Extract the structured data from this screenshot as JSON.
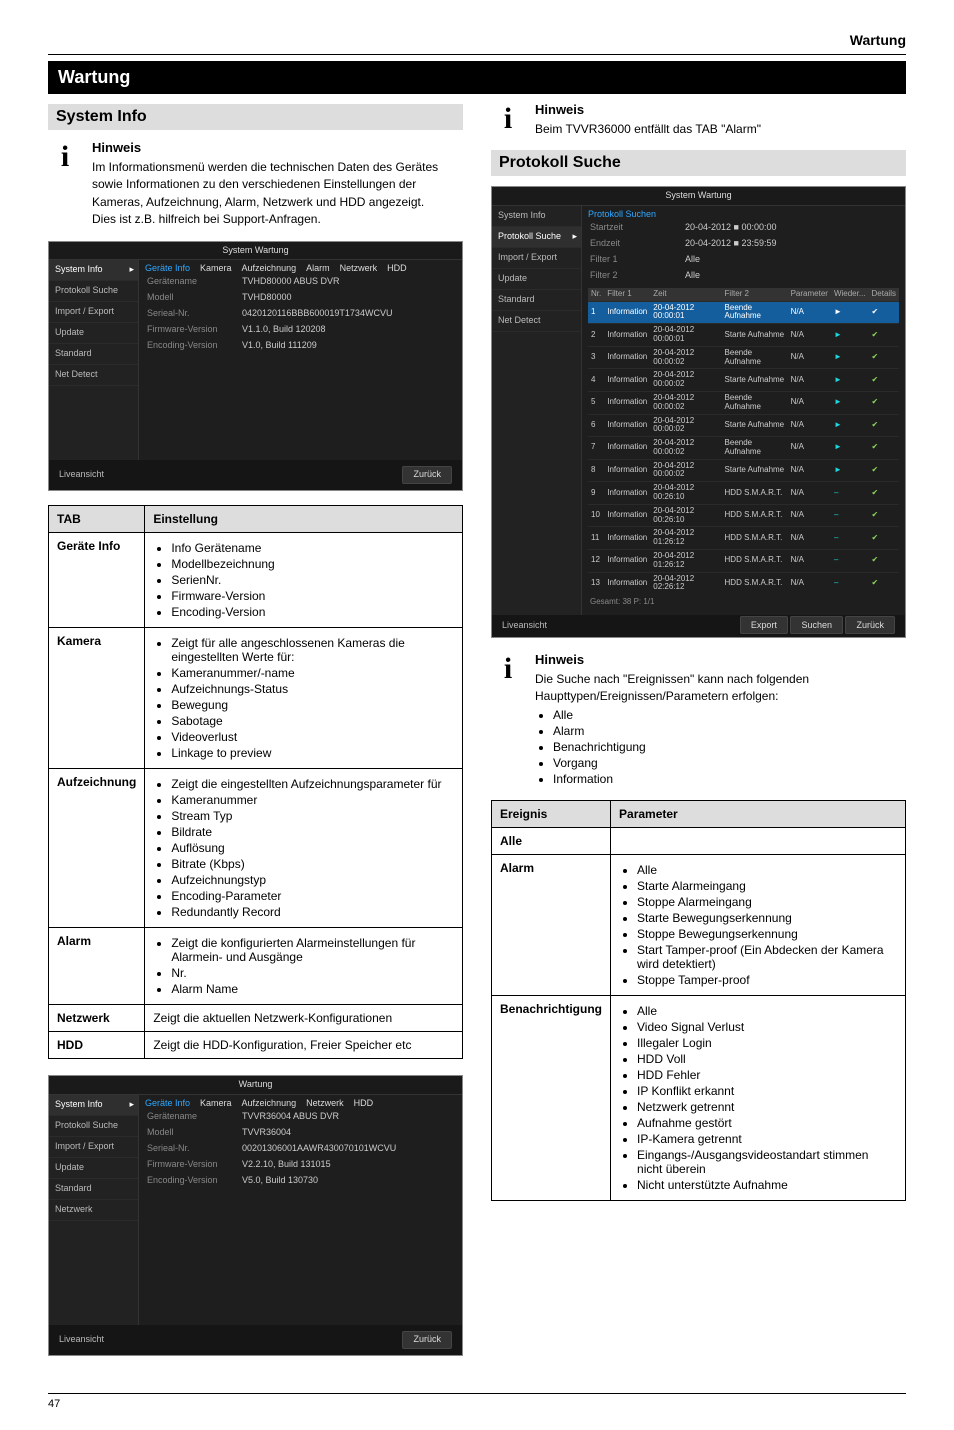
{
  "top_heading": "Wartung",
  "band_title": "Wartung",
  "hint_label": "Hinweis",
  "sysinfo": {
    "heading": "System Info",
    "note1": "Im Informationsmenü werden die technischen Daten des Gerätes sowie Informationen zu den verschiedenen Einstellungen der Kameras, Aufzeichnung, Alarm, Netzwerk und HDD angezeigt.",
    "note2": "Dies ist z.B. hilfreich bei Support-Anfragen.",
    "shot": {
      "title": "System Wartung",
      "side": [
        "System Info",
        "Protokoll Suche",
        "Import / Export",
        "Update",
        "Standard",
        "Net Detect"
      ],
      "side_sel": 0,
      "tabs": [
        "Geräte Info",
        "Kamera",
        "Aufzeichnung",
        "Alarm",
        "Netzwerk",
        "HDD"
      ],
      "kv": [
        {
          "k": "Gerätename",
          "v": "TVHD80000 ABUS DVR"
        },
        {
          "k": "Modell",
          "v": "TVHD80000"
        },
        {
          "k": "Serieal-Nr.",
          "v": "0420120116BBB600019T1734WCVU"
        },
        {
          "k": "Firmware-Version",
          "v": "V1.1.0, Build 120208"
        },
        {
          "k": "Encoding-Version",
          "v": "V1.0, Build 111209"
        }
      ],
      "live": "Liveansicht",
      "back": "Zurück"
    },
    "table": {
      "headers": [
        "TAB",
        "Einstellung"
      ],
      "rows": [
        {
          "tab": "Geräte Info",
          "text": "Info Gerätename\nModellbezeichnung\nSerienNr.\nFirmware-Version\nEncoding-Version",
          "rowspan": 0
        },
        {
          "tab": "Kamera",
          "text": "Zeigt für alle angeschlossenen Kameras die eingestellten Werte für:\nKameranummer/-name\nAufzeichnungs-Status\nBewegung\nSabotage\nVideoverlust\nLinkage to preview"
        },
        {
          "tab": "Aufzeichnung",
          "text": "Zeigt die eingestellten Aufzeichnungsparameter für\nKameranummer\nStream Typ\nBildrate\nAuflösung\nBitrate (Kbps)\nAufzeichnungstyp\nEncoding-Parameter\nRedundantly Record"
        },
        {
          "tab": "Alarm",
          "text": "Zeigt die konfigurierten Alarmeinstellungen für Alarmein- und Ausgänge\nNr.\nAlarm Name"
        },
        {
          "tab": "Netzwerk",
          "text": "Zeigt die aktuellen Netzwerk-Konfigurationen"
        },
        {
          "tab": "HDD",
          "text": "Zeigt die HDD-Konfiguration, Freier Speicher etc"
        }
      ]
    },
    "shot2": {
      "title": "Wartung",
      "side": [
        "System Info",
        "Protokoll Suche",
        "Import / Export",
        "Update",
        "Standard",
        "Netzwerk"
      ],
      "side_sel": 0,
      "tabs": [
        "Geräte Info",
        "Kamera",
        "Aufzeichnung",
        "Netzwerk",
        "HDD"
      ],
      "kv": [
        {
          "k": "Gerätename",
          "v": "TVVR36004 ABUS DVR"
        },
        {
          "k": "Modell",
          "v": "TVVR36004"
        },
        {
          "k": "Serieal-Nr.",
          "v": "00201306001AAWR430070101WCVU"
        },
        {
          "k": "Firmware-Version",
          "v": "V2.2.10, Build 131015"
        },
        {
          "k": "Encoding-Version",
          "v": "V5.0, Build 130730"
        }
      ],
      "live": "Liveansicht",
      "back": "Zurück"
    },
    "note3": "Beim TVVR36000 entfällt das TAB \"Alarm\""
  },
  "protokoll": {
    "heading": "Protokoll Suche",
    "note": "Die Suche nach \"Ereignissen\" kann nach folgenden Haupttypen/Ereignissen/Parametern erfolgen:",
    "types": [
      "Alle",
      "Alarm",
      "Benachrichtigung",
      "Vorgang",
      "Information"
    ],
    "shot": {
      "title": "System Wartung",
      "side": [
        "System Info",
        "Protokoll Suche",
        "Import / Export",
        "Update",
        "Standard",
        "Net Detect"
      ],
      "side_sel": 1,
      "tabs": [
        "Protokoll Suchen"
      ],
      "fields": [
        {
          "label": "Startzeit",
          "date": "20-04-2012",
          "time": "00:00:00"
        },
        {
          "label": "Endzeit",
          "date": "20-04-2012",
          "time": "23:59:59"
        },
        {
          "label": "Filter 1",
          "val": "Alle"
        },
        {
          "label": "Filter 2",
          "val": "Alle"
        }
      ],
      "cols": [
        "Nr.",
        "Filter 1",
        "Zeit",
        "Filter 2",
        "Parameter",
        "Wieder...",
        "Details"
      ],
      "rows": [
        {
          "n": 1,
          "f": "Information",
          "t": "20-04-2012 00:00:01",
          "e": "Beende Aufnahme",
          "p": "N/A",
          "play": "►",
          "d": "✔",
          "hl": true
        },
        {
          "n": 2,
          "f": "Information",
          "t": "20-04-2012 00:00:01",
          "e": "Starte Aufnahme",
          "p": "N/A",
          "play": "►",
          "d": "✔"
        },
        {
          "n": 3,
          "f": "Information",
          "t": "20-04-2012 00:00:02",
          "e": "Beende Aufnahme",
          "p": "N/A",
          "play": "►",
          "d": "✔"
        },
        {
          "n": 4,
          "f": "Information",
          "t": "20-04-2012 00:00:02",
          "e": "Starte Aufnahme",
          "p": "N/A",
          "play": "►",
          "d": "✔"
        },
        {
          "n": 5,
          "f": "Information",
          "t": "20-04-2012 00:00:02",
          "e": "Beende Aufnahme",
          "p": "N/A",
          "play": "►",
          "d": "✔"
        },
        {
          "n": 6,
          "f": "Information",
          "t": "20-04-2012 00:00:02",
          "e": "Starte Aufnahme",
          "p": "N/A",
          "play": "►",
          "d": "✔"
        },
        {
          "n": 7,
          "f": "Information",
          "t": "20-04-2012 00:00:02",
          "e": "Beende Aufnahme",
          "p": "N/A",
          "play": "►",
          "d": "✔"
        },
        {
          "n": 8,
          "f": "Information",
          "t": "20-04-2012 00:00:02",
          "e": "Starte Aufnahme",
          "p": "N/A",
          "play": "►",
          "d": "✔"
        },
        {
          "n": 9,
          "f": "Information",
          "t": "20-04-2012 00:26:10",
          "e": "HDD S.M.A.R.T.",
          "p": "N/A",
          "play": "–",
          "d": "✔"
        },
        {
          "n": 10,
          "f": "Information",
          "t": "20-04-2012 00:26:10",
          "e": "HDD S.M.A.R.T.",
          "p": "N/A",
          "play": "–",
          "d": "✔"
        },
        {
          "n": 11,
          "f": "Information",
          "t": "20-04-2012 01:26:12",
          "e": "HDD S.M.A.R.T.",
          "p": "N/A",
          "play": "–",
          "d": "✔"
        },
        {
          "n": 12,
          "f": "Information",
          "t": "20-04-2012 01:26:12",
          "e": "HDD S.M.A.R.T.",
          "p": "N/A",
          "play": "–",
          "d": "✔"
        },
        {
          "n": 13,
          "f": "Information",
          "t": "20-04-2012 02:26:12",
          "e": "HDD S.M.A.R.T.",
          "p": "N/A",
          "play": "–",
          "d": "✔"
        }
      ],
      "total": "Gesamt: 38  P: 1/1",
      "live": "Liveansicht",
      "btn_export": "Export",
      "btn_search": "Suchen",
      "btn_back": "Zurück"
    },
    "table": {
      "headers": [
        "Ereignis",
        "Parameter"
      ],
      "rows": [
        {
          "k": "Alle",
          "items": []
        },
        {
          "k": "Alarm",
          "items": [
            "Alle",
            "Starte Alarmeingang",
            "Stoppe Alarmeingang",
            "Starte Bewegungserkennung",
            "Stoppe Bewegungserkennung",
            "Start Tamper-proof (Ein Abdecken der Kamera wird detektiert)",
            "Stoppe Tamper-proof"
          ]
        },
        {
          "k": "Benachrichtigung",
          "items": [
            "Alle",
            "Video Signal Verlust",
            "Illegaler Login",
            "HDD Voll",
            "HDD Fehler",
            "IP Konflikt erkannt",
            "Netzwerk getrennt",
            "Aufnahme gestört",
            "IP-Kamera getrennt",
            "Eingangs-/Ausgangsvideostandart stimmen nicht überein",
            "Nicht unterstützte Aufnahme"
          ]
        }
      ]
    }
  },
  "footer": "47"
}
